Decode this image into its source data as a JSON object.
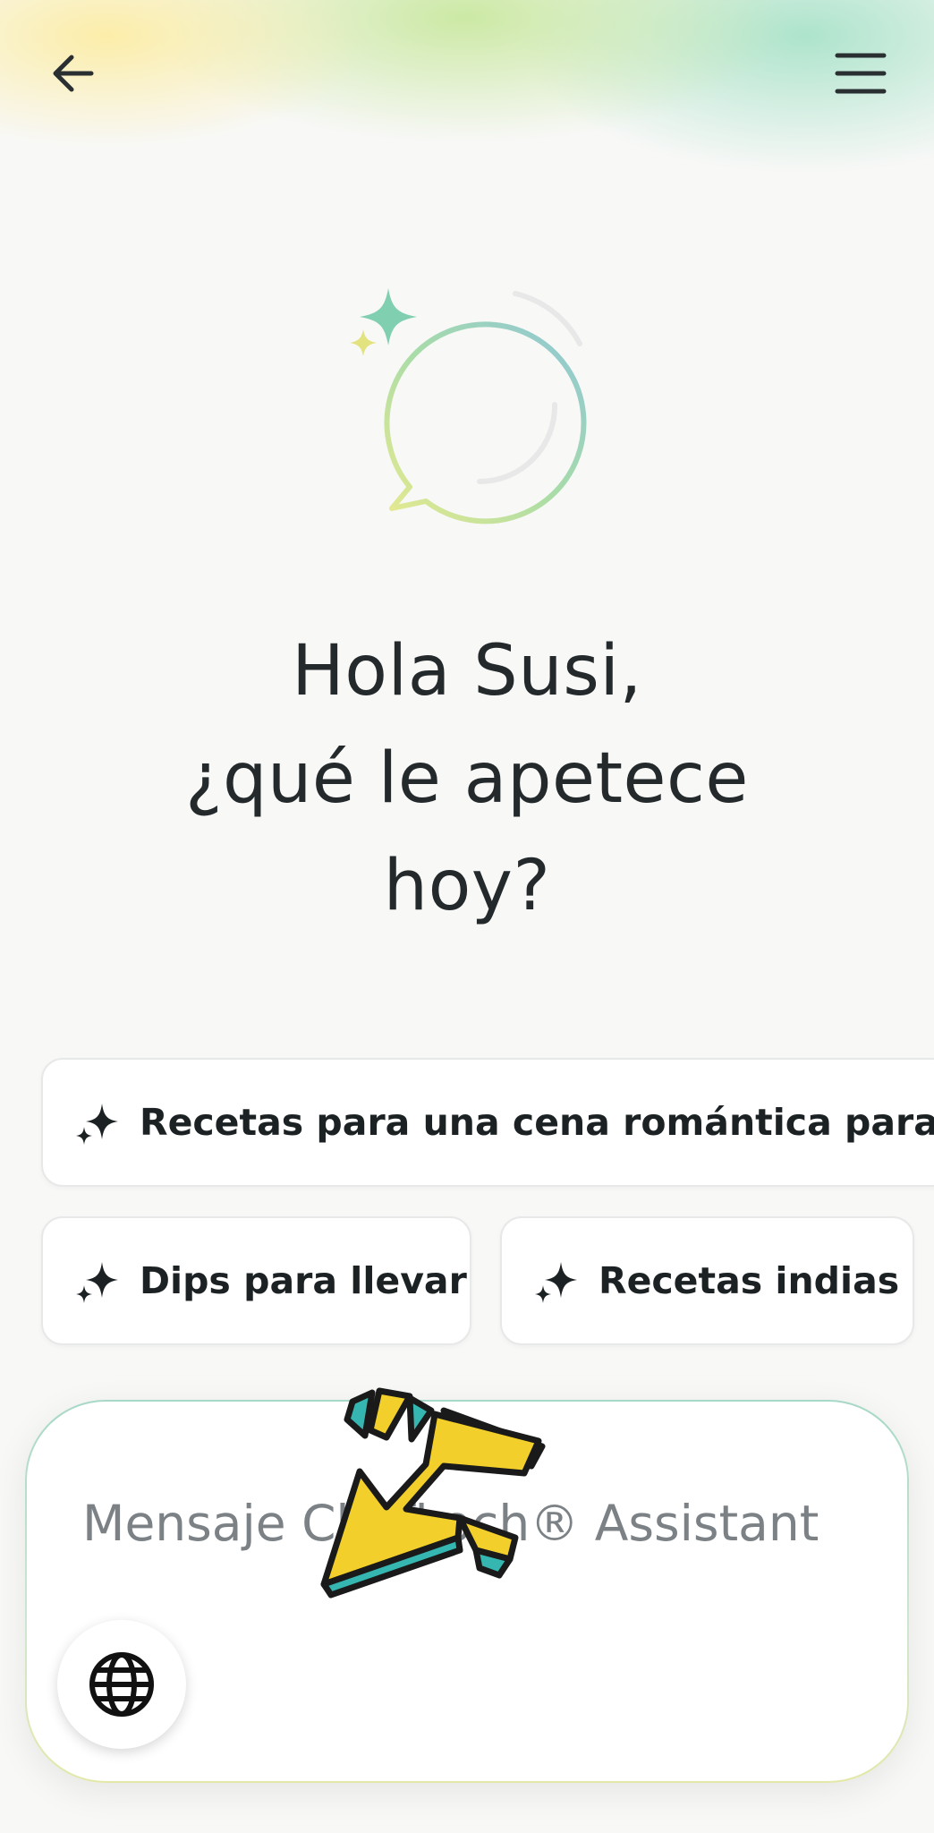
{
  "header": {
    "back_icon": "arrow-left-icon",
    "menu_icon": "hamburger-menu-icon"
  },
  "greeting": {
    "line1": "Hola Susi,",
    "line2": "¿qué le apetece",
    "line3": "hoy?"
  },
  "suggestions": [
    {
      "label": "Recetas para una cena romántica para dos",
      "icon": "sparkle-icon"
    },
    {
      "label": "Dips para llevar",
      "icon": "sparkle-icon"
    },
    {
      "label": "Recetas indias",
      "icon": "sparkle-icon"
    }
  ],
  "composer": {
    "placeholder": "Mensaje Chefkoch® Assistant",
    "value": "",
    "globe_icon": "globe-icon"
  },
  "colors": {
    "background": "#f8f8f7",
    "text": "#24292b",
    "accent_green": "#7fcfb0",
    "accent_yellow": "#e8e48a",
    "accent_blue": "#8fc4d6",
    "arrow_yellow": "#f2cf2a",
    "arrow_teal": "#36b6b0"
  }
}
